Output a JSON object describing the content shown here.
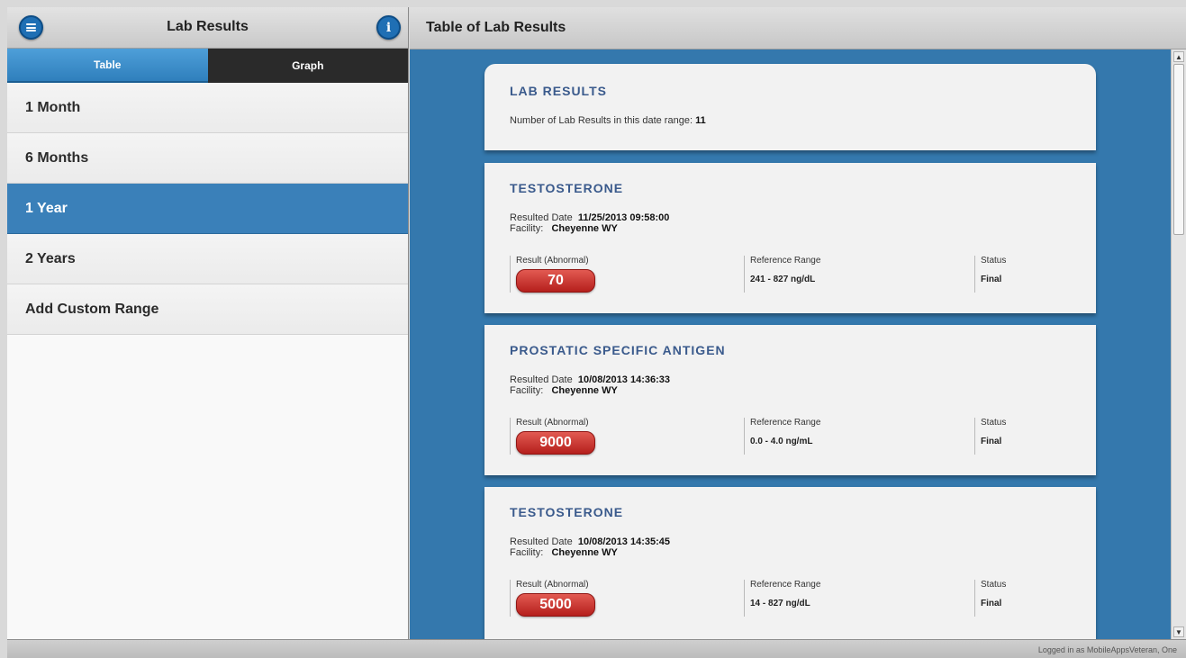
{
  "left_panel": {
    "title": "Lab Results",
    "menu_icon": "menu-icon",
    "info_icon": "info-icon",
    "tabs": [
      {
        "label": "Table",
        "active": true
      },
      {
        "label": "Graph",
        "active": false
      }
    ],
    "ranges": [
      {
        "label": "1 Month",
        "selected": false
      },
      {
        "label": "6 Months",
        "selected": false
      },
      {
        "label": "1 Year",
        "selected": true
      },
      {
        "label": "2 Years",
        "selected": false
      },
      {
        "label": "Add Custom Range",
        "selected": false
      }
    ]
  },
  "right_panel": {
    "title": "Table of Lab Results",
    "summary": {
      "heading": "LAB RESULTS",
      "count_label": "Number of Lab Results in this date range:",
      "count_value": "11"
    },
    "column_labels": {
      "result": "Result (Abnormal)",
      "range": "Reference Range",
      "status": "Status"
    },
    "results": [
      {
        "name": "TESTOSTERONE",
        "resulted_label": "Resulted Date",
        "resulted_date": "11/25/2013 09:58:00",
        "facility_label": "Facility:",
        "facility": "Cheyenne WY",
        "value": "70",
        "reference_range": "241 - 827 ng/dL",
        "status": "Final"
      },
      {
        "name": "PROSTATIC SPECIFIC ANTIGEN",
        "resulted_label": "Resulted Date",
        "resulted_date": "10/08/2013 14:36:33",
        "facility_label": "Facility:",
        "facility": "Cheyenne WY",
        "value": "9000",
        "reference_range": "0.0 - 4.0 ng/mL",
        "status": "Final"
      },
      {
        "name": "TESTOSTERONE",
        "resulted_label": "Resulted Date",
        "resulted_date": "10/08/2013 14:35:45",
        "facility_label": "Facility:",
        "facility": "Cheyenne WY",
        "value": "5000",
        "reference_range": "14 - 827 ng/dL",
        "status": "Final"
      }
    ]
  },
  "footer": {
    "logged_in_text": "Logged in as MobileAppsVeteran, One"
  },
  "colors": {
    "accent_blue": "#3478ad",
    "abnormal_red": "#c22f2a",
    "dark_tab": "#2a2a2a"
  }
}
